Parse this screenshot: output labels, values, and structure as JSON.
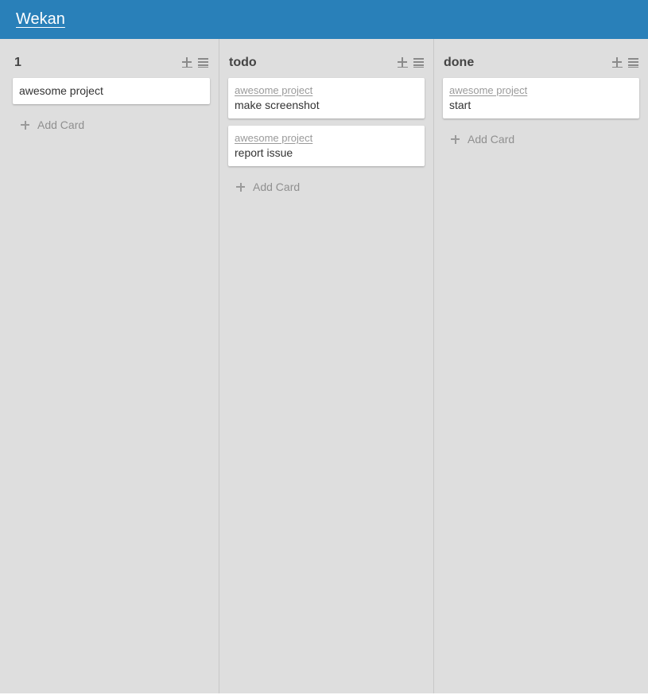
{
  "app": {
    "brand": "Wekan"
  },
  "colors": {
    "header": "#2980b9",
    "board_bg": "#dedede",
    "card_bg": "#ffffff"
  },
  "icons": {
    "add_list_card": "plus-icon",
    "list_menu": "hamburger-menu-icon",
    "add_card": "plus-icon"
  },
  "lists": [
    {
      "title": "1",
      "cards": [
        {
          "project": "",
          "title": "awesome project"
        }
      ],
      "add_card_label": "Add Card"
    },
    {
      "title": "todo",
      "cards": [
        {
          "project": "awesome project",
          "title": "make screenshot"
        },
        {
          "project": "awesome project",
          "title": "report issue"
        }
      ],
      "add_card_label": "Add Card"
    },
    {
      "title": "done",
      "cards": [
        {
          "project": "awesome project",
          "title": "start"
        }
      ],
      "add_card_label": "Add Card"
    }
  ]
}
